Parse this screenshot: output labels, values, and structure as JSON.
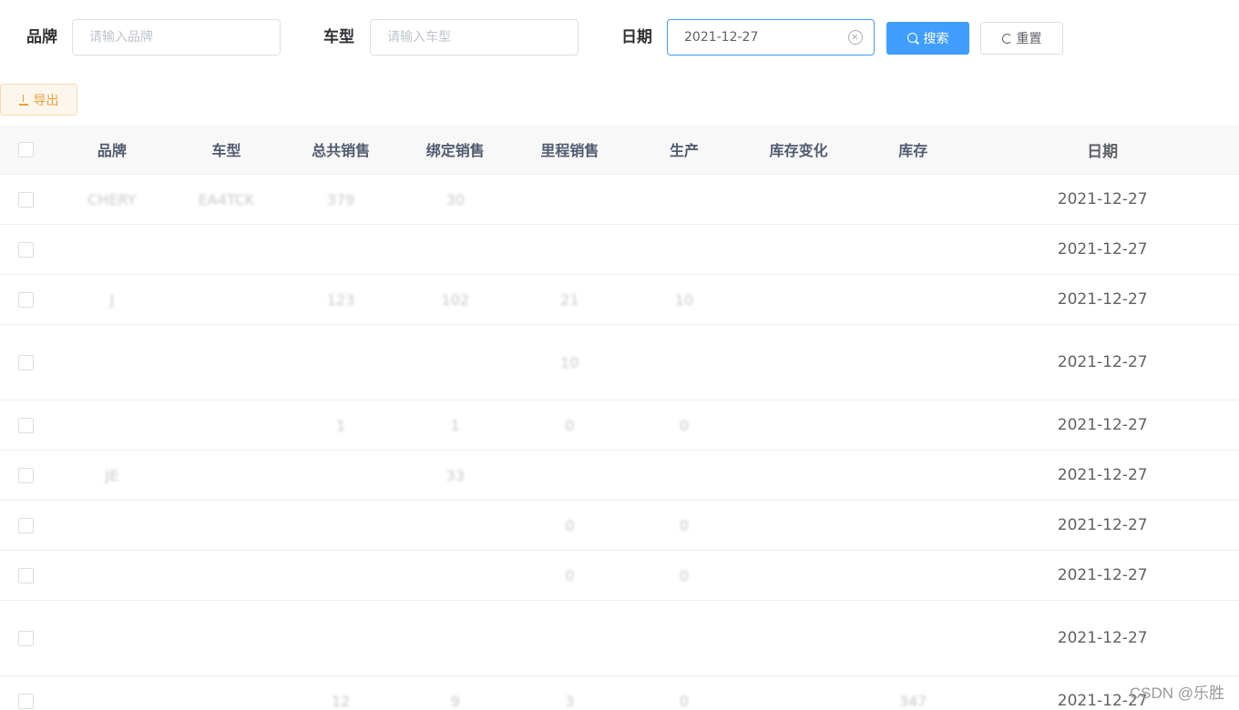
{
  "filters": {
    "brand": {
      "label": "品牌",
      "placeholder": "请输入品牌",
      "value": ""
    },
    "model": {
      "label": "车型",
      "placeholder": "请输入车型",
      "value": ""
    },
    "date": {
      "label": "日期",
      "value": "2021-12-27"
    },
    "search_label": "搜索",
    "reset_label": "重置"
  },
  "toolbar": {
    "export_label": "导出"
  },
  "table": {
    "headers": [
      "品牌",
      "车型",
      "总共销售",
      "绑定销售",
      "里程销售",
      "生产",
      "库存变化",
      "库存",
      "日期"
    ],
    "rows": [
      {
        "brand": "CHERY",
        "model": "EA4TCK",
        "total": "379",
        "bind": "30",
        "mile": "",
        "prod": "",
        "stockchg": "",
        "stock": "",
        "date": "2021-12-27",
        "height": 55
      },
      {
        "brand": "",
        "model": "",
        "total": "",
        "bind": "",
        "mile": "",
        "prod": "",
        "stockchg": "",
        "stock": "",
        "date": "2021-12-27",
        "height": 55
      },
      {
        "brand": "J",
        "model": "",
        "total": "123",
        "bind": "102",
        "mile": "21",
        "prod": "10",
        "stockchg": "",
        "stock": "",
        "date": "2021-12-27",
        "height": 55
      },
      {
        "brand": "",
        "model": "",
        "total": "",
        "bind": "",
        "mile": "10",
        "prod": "",
        "stockchg": "",
        "stock": "",
        "date": "2021-12-27",
        "height": 83
      },
      {
        "brand": "",
        "model": "",
        "total": "1",
        "bind": "1",
        "mile": "0",
        "prod": "0",
        "stockchg": "",
        "stock": "",
        "date": "2021-12-27",
        "height": 55
      },
      {
        "brand": "JE",
        "model": "",
        "total": "",
        "bind": "33",
        "mile": "",
        "prod": "",
        "stockchg": "",
        "stock": "",
        "date": "2021-12-27",
        "height": 55
      },
      {
        "brand": "",
        "model": "",
        "total": "",
        "bind": "",
        "mile": "0",
        "prod": "0",
        "stockchg": "",
        "stock": "",
        "date": "2021-12-27",
        "height": 55
      },
      {
        "brand": "",
        "model": "",
        "total": "",
        "bind": "",
        "mile": "0",
        "prod": "0",
        "stockchg": "",
        "stock": "",
        "date": "2021-12-27",
        "height": 55
      },
      {
        "brand": "",
        "model": "",
        "total": "",
        "bind": "",
        "mile": "",
        "prod": "",
        "stockchg": "",
        "stock": "",
        "date": "2021-12-27",
        "height": 83
      },
      {
        "brand": "",
        "model": "",
        "total": "12",
        "bind": "9",
        "mile": "3",
        "prod": "0",
        "stockchg": "",
        "stock": "347",
        "date": "2021-12-27",
        "height": 55
      }
    ]
  },
  "watermark": "CSDN @乐胜"
}
